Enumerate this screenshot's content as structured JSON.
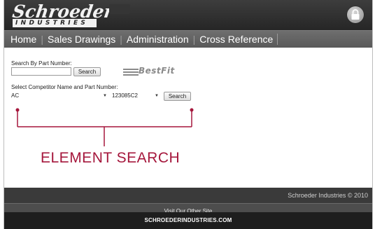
{
  "header": {
    "logo_main": "Schroeder",
    "logo_sub": "INDUSTRIES",
    "lock_icon": "lock-icon"
  },
  "nav": {
    "items": [
      {
        "label": "Home"
      },
      {
        "label": "Sales Drawings"
      },
      {
        "label": "Administration"
      },
      {
        "label": "Cross Reference"
      }
    ]
  },
  "part_search": {
    "label": "Search By Part Number:",
    "input_value": "",
    "button_label": "Search"
  },
  "bestfit_logo": "BestFit",
  "competitor_search": {
    "label": "Select Competitor Name and Part Number:",
    "competitor_selected": "AC",
    "part_selected": "123085C2",
    "button_label": "Search"
  },
  "annotation": {
    "text": "ELEMENT SEARCH",
    "color": "#a5173c"
  },
  "footer": {
    "copyright": "Schroeder Industries © 2010",
    "other_site": "Visit Our Other Site",
    "site_link": "SCHROEDERINDUSTRIES.COM"
  }
}
